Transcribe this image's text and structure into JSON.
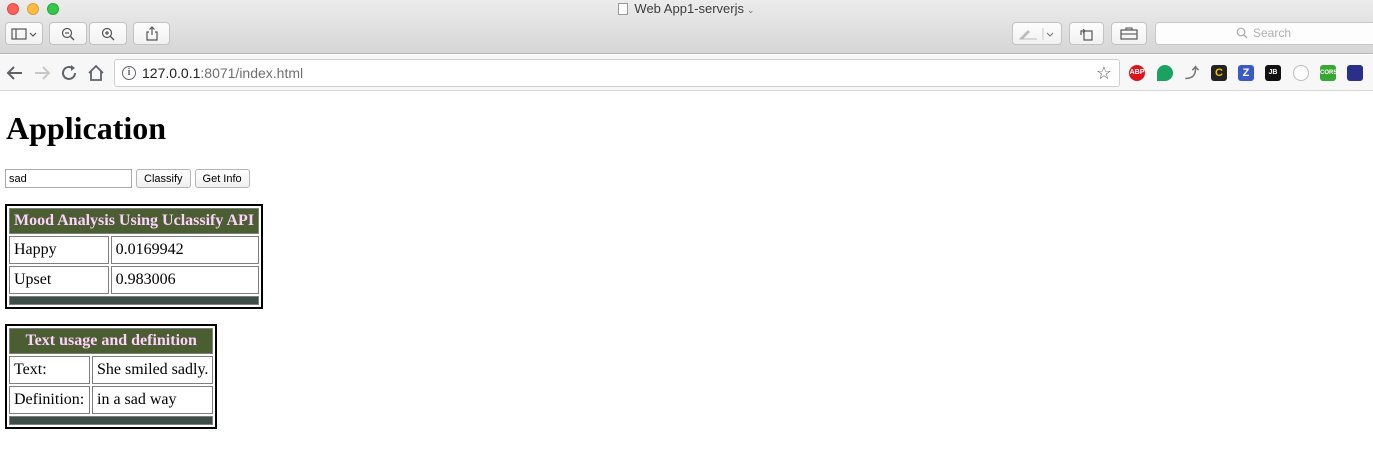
{
  "window": {
    "title": "Web App1-serverjs",
    "search_placeholder": "Search"
  },
  "navbar": {
    "url_host": "127.0.0.1",
    "url_path": ":8071/index.html",
    "extensions": [
      "ABP",
      "",
      "",
      "",
      "Z",
      "JB",
      "",
      "CORS",
      ""
    ]
  },
  "page": {
    "heading": "Application",
    "input_value": "sad",
    "classify_label": "Classify",
    "getinfo_label": "Get Info"
  },
  "mood_table": {
    "title": "Mood Analysis Using Uclassify API",
    "rows": [
      {
        "label": "Happy",
        "value": "0.0169942"
      },
      {
        "label": "Upset",
        "value": "0.983006"
      }
    ]
  },
  "info_table": {
    "title": "Text usage and definition",
    "rows": [
      {
        "label": "Text:",
        "value": "She smiled sadly."
      },
      {
        "label": "Definition:",
        "value": "in a sad way"
      }
    ]
  },
  "colors": {
    "table_header_bg": "#4a5e32",
    "table_header_text": "#ffd1ff",
    "table_footer_bg": "#3d4e49"
  }
}
